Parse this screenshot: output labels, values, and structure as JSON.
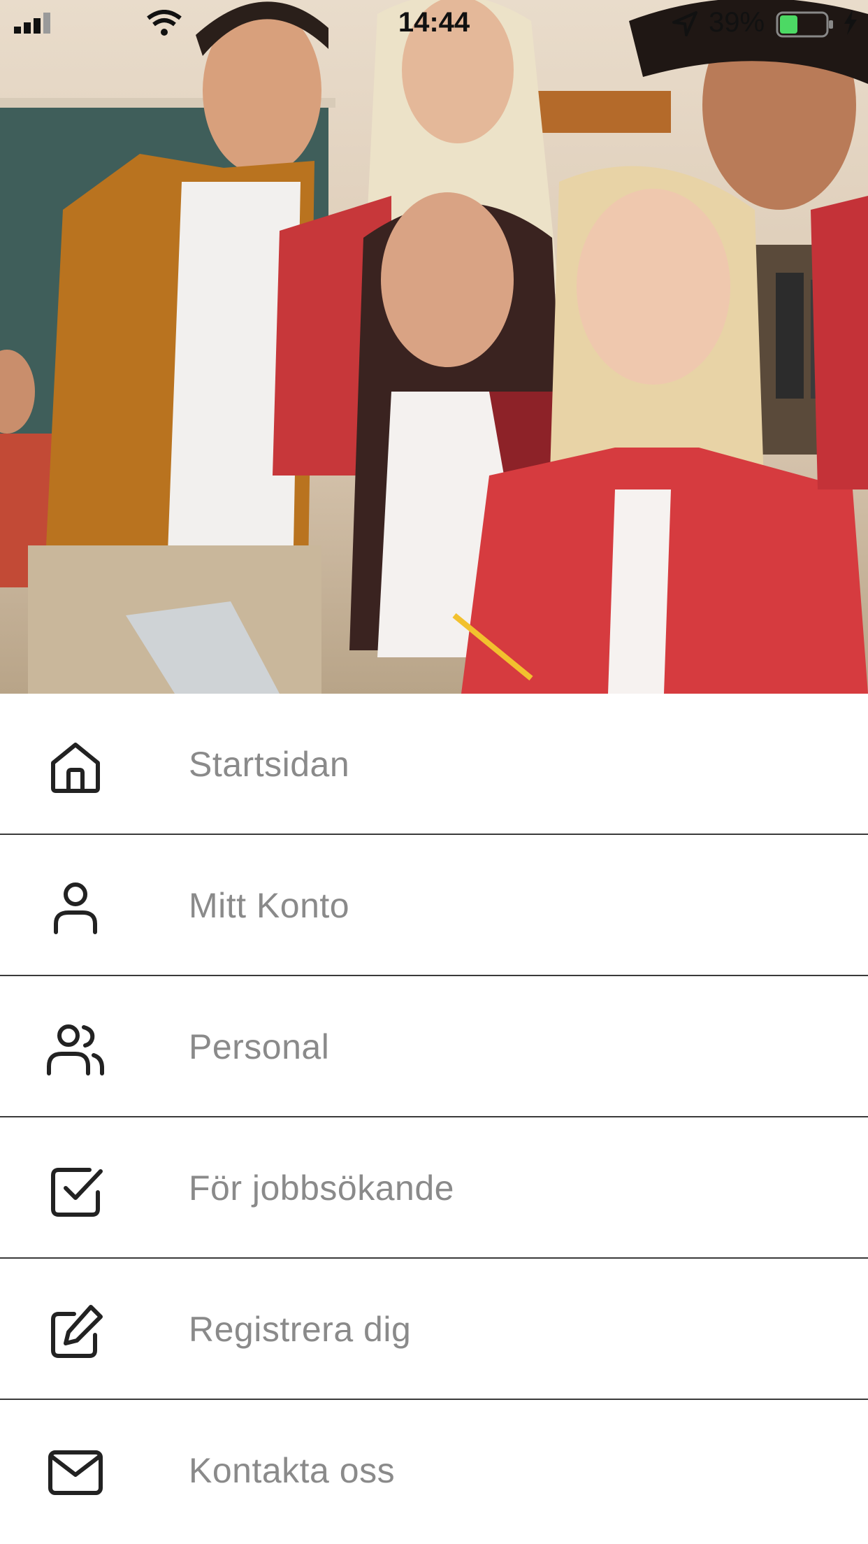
{
  "status_bar": {
    "time": "14:44",
    "battery_percent": "39%",
    "battery_level": 0.39,
    "battery_color": "#4cd964",
    "signal_icon": "cellular-signal-icon",
    "wifi_icon": "wifi-icon",
    "location_icon": "location-arrow-icon",
    "charging_icon": "charging-bolt-icon"
  },
  "hero": {
    "icon": "students-group-photo"
  },
  "menu": {
    "items": [
      {
        "label": "Startsidan",
        "icon": "home-icon"
      },
      {
        "label": "Mitt Konto",
        "icon": "user-icon"
      },
      {
        "label": "Personal",
        "icon": "users-icon"
      },
      {
        "label": "För jobbsökande",
        "icon": "checkbox-icon"
      },
      {
        "label": "Registrera dig",
        "icon": "edit-icon"
      },
      {
        "label": "Kontakta oss",
        "icon": "mail-icon"
      }
    ],
    "label_color": "#8a8a8a",
    "divider_color": "#3a3a3a"
  }
}
